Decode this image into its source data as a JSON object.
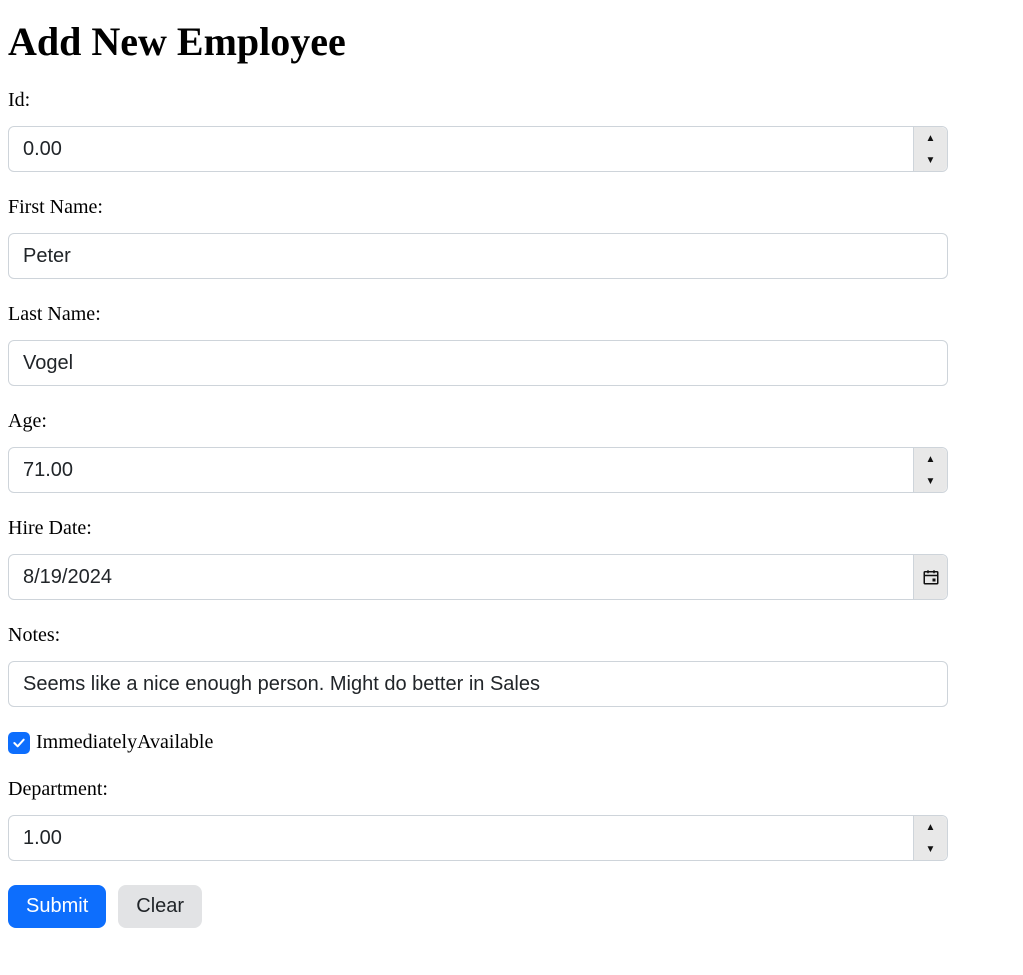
{
  "page": {
    "title": "Add New Employee"
  },
  "labels": {
    "id": "Id:",
    "firstName": "First Name:",
    "lastName": "Last Name:",
    "age": "Age:",
    "hireDate": "Hire Date:",
    "notes": "Notes:",
    "immediatelyAvailable": "ImmediatelyAvailable",
    "department": "Department:"
  },
  "values": {
    "id": "0.00",
    "firstName": "Peter",
    "lastName": "Vogel",
    "age": "71.00",
    "hireDate": "8/19/2024",
    "notes": "Seems like a nice enough person. Might do better in Sales",
    "immediatelyAvailable": true,
    "department": "1.00"
  },
  "buttons": {
    "submit": "Submit",
    "clear": "Clear"
  }
}
